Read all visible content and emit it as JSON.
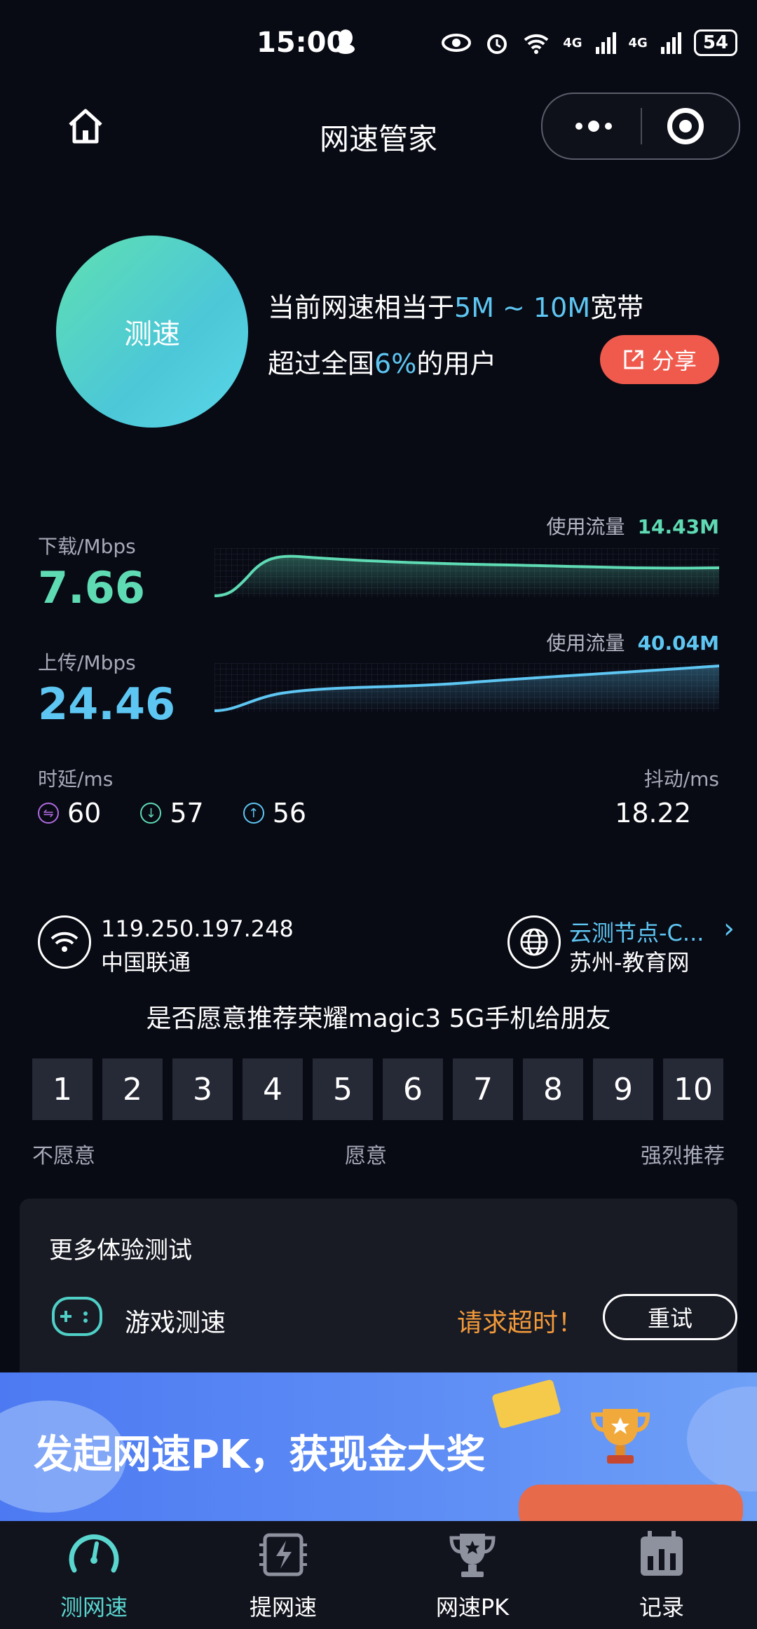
{
  "status_bar": {
    "time": "15:00",
    "battery": "54",
    "network_a": "4G",
    "network_b": "4G"
  },
  "header": {
    "title": "网速管家"
  },
  "summary": {
    "test_button": "测速",
    "line1_prefix": "当前网速相当于",
    "line1_value": "5M ~ 10M",
    "line1_suffix": "宽带",
    "line2_prefix": "超过全国",
    "line2_value": "6%",
    "line2_suffix": "的用户",
    "share_label": "分享"
  },
  "download": {
    "label": "下载/Mbps",
    "value": "7.66",
    "usage_label": "使用流量",
    "usage_value": "14.43M"
  },
  "upload": {
    "label": "上传/Mbps",
    "value": "24.46",
    "usage_label": "使用流量",
    "usage_value": "40.04M"
  },
  "latency": {
    "label": "时延/ms",
    "values": [
      "60",
      "57",
      "56"
    ]
  },
  "jitter": {
    "label": "抖动/ms",
    "value": "18.22"
  },
  "network": {
    "ip": "119.250.197.248",
    "isp": "中国联通",
    "node": "云测节点-C...",
    "node_location": "苏州-教育网"
  },
  "rating": {
    "question": "是否愿意推荐荣耀magic3 5G手机给朋友",
    "options": [
      "1",
      "2",
      "3",
      "4",
      "5",
      "6",
      "7",
      "8",
      "9",
      "10"
    ],
    "scale_low": "不愿意",
    "scale_mid": "愿意",
    "scale_high": "强烈推荐"
  },
  "more_tests": {
    "title": "更多体验测试",
    "game_label": "游戏测速",
    "status": "请求超时！",
    "retry_label": "重试"
  },
  "banner": {
    "text": "发起网速PK，获现金大奖"
  },
  "nav": [
    {
      "label": "测网速",
      "active": true
    },
    {
      "label": "提网速",
      "active": false
    },
    {
      "label": "网速PK",
      "active": false
    },
    {
      "label": "记录",
      "active": false
    }
  ],
  "colors": {
    "download": "#5fdbb4",
    "upload": "#5ec6f2",
    "share": "#ef5a4c",
    "timeout": "#f29a3a",
    "nav_active": "#5ad6cf"
  }
}
